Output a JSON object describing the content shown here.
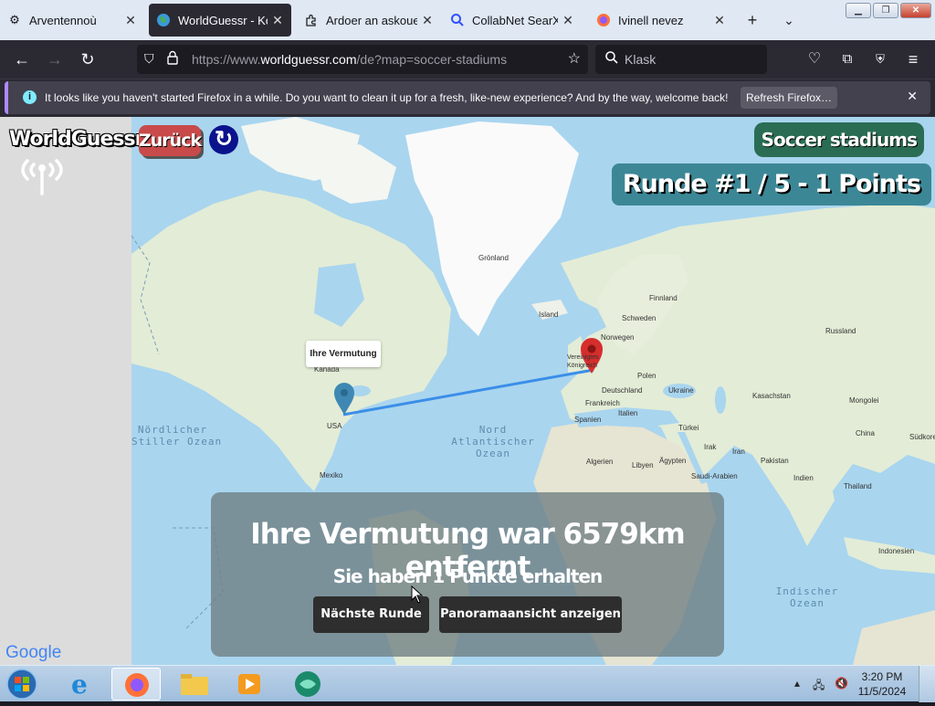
{
  "tabs": [
    {
      "label": "Arventennoù",
      "icon": "gear-icon"
    },
    {
      "label": "WorldGuessr - Kost",
      "icon": "globe-icon",
      "active": true
    },
    {
      "label": "Ardoer an askouezh",
      "icon": "puzzle-icon"
    },
    {
      "label": "CollabNet SearXNG",
      "icon": "search-icon"
    },
    {
      "label": "Ivinell nevez",
      "icon": "firefox-icon"
    }
  ],
  "nav": {
    "url_prefix": "https://www.",
    "url_host": "worldguessr.com",
    "url_path": "/de?map=soccer-stadiums",
    "search_placeholder": "Klask"
  },
  "notification": {
    "message": "It looks like you haven't started Firefox in a while. Do you want to clean it up for a fresh, like-new experience? And by the way, welcome back!",
    "button": "Refresh Firefox…"
  },
  "game": {
    "logo": "WorldGuessr",
    "back_label": "Zurück",
    "map_name": "Soccer stadiums",
    "round_info": "Runde #1 / 5 - 1 Points",
    "guess_label": "Ihre Vermutung",
    "result_title": "Ihre Vermutung war 6579km entfernt",
    "result_points": "Sie haben 1 Punkte erhalten",
    "next_button": "Nächste Runde",
    "pano_button": "Panoramaansicht anzeigen",
    "google_logo": "Google"
  },
  "map_labels": [
    "Grönland",
    "Island",
    "Finnland",
    "Schweden",
    "Norwegen",
    "Russland",
    "Vereinigtes Königreich",
    "Polen",
    "Deutschland",
    "Ukraine",
    "Kasachstan",
    "Mongolei",
    "Frankreich",
    "Italien",
    "Spanien",
    "Türkei",
    "China",
    "Irak",
    "Iran",
    "Algerien",
    "Libyen",
    "Ägypten",
    "Saudi-Arabien",
    "Pakistan",
    "Indien",
    "Thailand",
    "Indonesien",
    "Kanada",
    "USA",
    "Mexiko",
    "Südkorea"
  ],
  "sea_labels": {
    "pacific": "Nördlicher\nStiller Ozean",
    "atlantic": "Nord\nAtlantischer\nOzean",
    "indian": "Indischer\nOzean"
  },
  "taskbar": {
    "time": "3:20 PM",
    "date": "11/5/2024"
  },
  "colors": {
    "tab_bg": "#dfe8f3",
    "toolbar": "#2b2a33",
    "water": "#a9d5ef",
    "land": "#e3ecd6",
    "guess_pin": "#3f88b3",
    "actual_pin": "#d32f2f",
    "line": "#3b8ee8"
  }
}
